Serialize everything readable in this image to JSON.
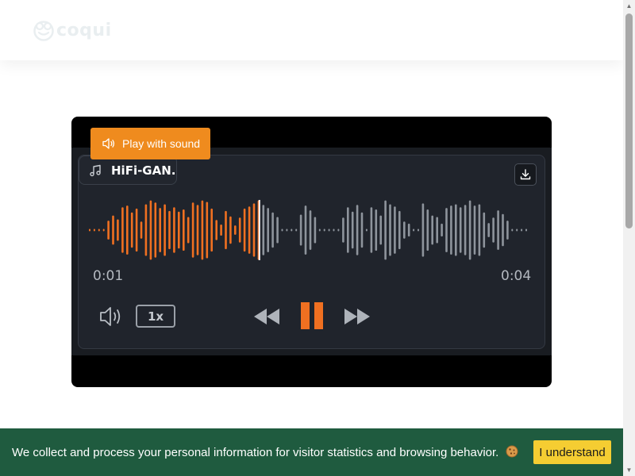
{
  "brand": {
    "name": "coqui",
    "logo_icon": "frog-face-icon",
    "logo_color": "#e9eef0"
  },
  "player": {
    "play_with_sound_label": "Play with sound",
    "play_with_sound_icon": "speaker-icon",
    "model_label": "HiFi-GAN.",
    "model_icon": "music-note-icon",
    "download_icon": "download-icon",
    "current_time": "0:01",
    "total_time": "0:04",
    "progress": 0.39,
    "speed_label": "1x",
    "volume_icon": "volume-icon",
    "rewind_icon": "rewind-icon",
    "pause_icon": "pause-icon",
    "forward_icon": "fast-forward-icon",
    "colors": {
      "played": "#f07021",
      "unplayed": "#8e949c",
      "accent": "#ef8b1e",
      "panel": "#20242c"
    },
    "waveform_levels": [
      0.05,
      0.05,
      0.05,
      0.05,
      0.28,
      0.45,
      0.32,
      0.72,
      0.78,
      0.55,
      0.68,
      0.25,
      0.82,
      0.95,
      0.88,
      0.7,
      0.82,
      0.6,
      0.72,
      0.58,
      0.65,
      0.4,
      0.88,
      0.8,
      0.95,
      0.9,
      0.68,
      0.3,
      0.15,
      0.6,
      0.42,
      0.12,
      0.38,
      0.68,
      0.75,
      0.85,
      0.95,
      0.8,
      0.7,
      0.55,
      0.4,
      0.05,
      0.05,
      0.05,
      0.05,
      0.48,
      0.78,
      0.62,
      0.4,
      0.05,
      0.05,
      0.05,
      0.05,
      0.05,
      0.38,
      0.72,
      0.58,
      0.8,
      0.55,
      0.05,
      0.72,
      0.65,
      0.45,
      0.95,
      0.82,
      0.75,
      0.6,
      0.25,
      0.18,
      0.05,
      0.05,
      0.85,
      0.65,
      0.45,
      0.4,
      0.18,
      0.7,
      0.78,
      0.82,
      0.72,
      0.8,
      0.95,
      0.78,
      0.82,
      0.55,
      0.2,
      0.38,
      0.62,
      0.5,
      0.28,
      0.05,
      0.05,
      0.05,
      0.05
    ]
  },
  "cookie": {
    "message": "We collect and process your personal information for visitor statistics and browsing behavior.",
    "emoji_icon": "cookie-icon",
    "accept_label": "I understand",
    "colors": {
      "bar": "#1f5b3f",
      "button": "#f5cd32"
    }
  }
}
